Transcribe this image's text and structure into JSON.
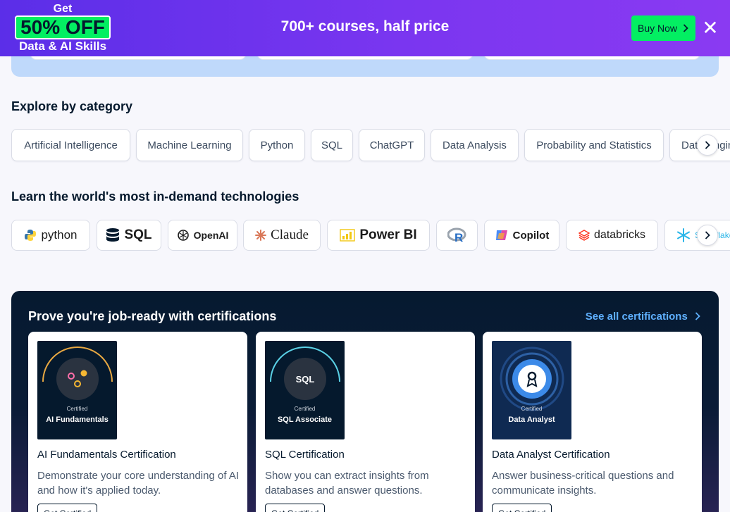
{
  "promo": {
    "get": "Get",
    "discount": "50% OFF",
    "subject": "Data & AI Skills",
    "headline": "700+ courses, half price",
    "buy_label": "Buy Now",
    "close_glyph": "✕",
    "colors": {
      "accent": "#03ef62",
      "banner": "#7a36f0"
    }
  },
  "categories": {
    "title": "Explore by category",
    "items": [
      "Artificial Intelligence",
      "Machine Learning",
      "Python",
      "SQL",
      "ChatGPT",
      "Data Analysis",
      "Probability and Statistics",
      "Data Engineering"
    ]
  },
  "technologies": {
    "title": "Learn the world's most in-demand technologies",
    "items": [
      {
        "name": "python",
        "icon": "python-logo-icon"
      },
      {
        "name": "SQL",
        "icon": "database-icon"
      },
      {
        "name": "OpenAI",
        "icon": "openai-logo-icon"
      },
      {
        "name": "Claude",
        "icon": "claude-logo-icon"
      },
      {
        "name": "Power BI",
        "icon": "power-bi-logo-icon"
      },
      {
        "name": "",
        "icon": "r-logo-icon"
      },
      {
        "name": "Copilot",
        "icon": "copilot-logo-icon"
      },
      {
        "name": "databricks",
        "icon": "databricks-logo-icon"
      },
      {
        "name": "Snowflake",
        "icon": "snowflake-logo-icon"
      }
    ]
  },
  "certifications": {
    "title": "Prove you're job-ready with certifications",
    "see_all": "See all certifications",
    "certified_label": "Certified",
    "items": [
      {
        "badge": "AI Fundamentals",
        "name": "AI Fundamentals Certification",
        "description": "Demonstrate your core understanding of AI and how it's applied today.",
        "button": "Get Certified"
      },
      {
        "badge": "SQL Associate",
        "badge_mark": "SQL",
        "name": "SQL Certification",
        "description": "Show you can extract insights from databases and answer questions.",
        "button": "Get Certified"
      },
      {
        "badge": "Data Analyst",
        "name": "Data Analyst Certification",
        "description": "Answer business-critical questions and communicate insights.",
        "button": "Get Certified"
      }
    ]
  }
}
